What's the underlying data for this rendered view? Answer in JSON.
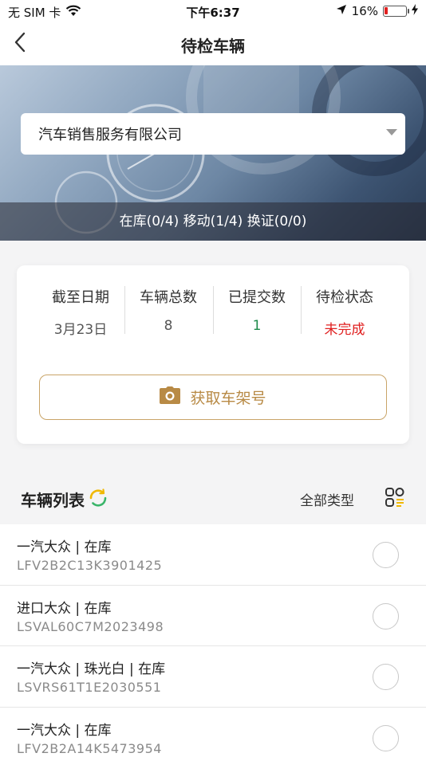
{
  "status_bar": {
    "carrier": "无 SIM 卡",
    "time": "下午6:37",
    "battery_percent": "16%",
    "battery_level": 0.16
  },
  "nav": {
    "title": "待检车辆"
  },
  "banner": {
    "company": "汽车销售服务有限公司",
    "summary": "在库(0/4) 移动(1/4) 换证(0/0)"
  },
  "stats": [
    {
      "label": "截至日期",
      "value": "3月23日",
      "color": "#555555"
    },
    {
      "label": "车辆总数",
      "value": "8",
      "color": "#555555"
    },
    {
      "label": "已提交数",
      "value": "1",
      "color": "#1e8a4a"
    },
    {
      "label": "待检状态",
      "value": "未完成",
      "color": "#e02020"
    }
  ],
  "frame_button": {
    "label": "获取车架号",
    "color": "#b88a45"
  },
  "list": {
    "title": "车辆列表",
    "type_filter": "全部类型",
    "items": [
      {
        "name": "一汽大众 | 在库",
        "vin": "LFV2B2C13K3901425"
      },
      {
        "name": "进口大众 | 在库",
        "vin": "LSVAL60C7M2023498"
      },
      {
        "name": "一汽大众 | 珠光白 | 在库",
        "vin": "LSVRS61T1E2030551"
      },
      {
        "name": "一汽大众 | 在库",
        "vin": "LFV2B2A14K5473954"
      }
    ]
  }
}
